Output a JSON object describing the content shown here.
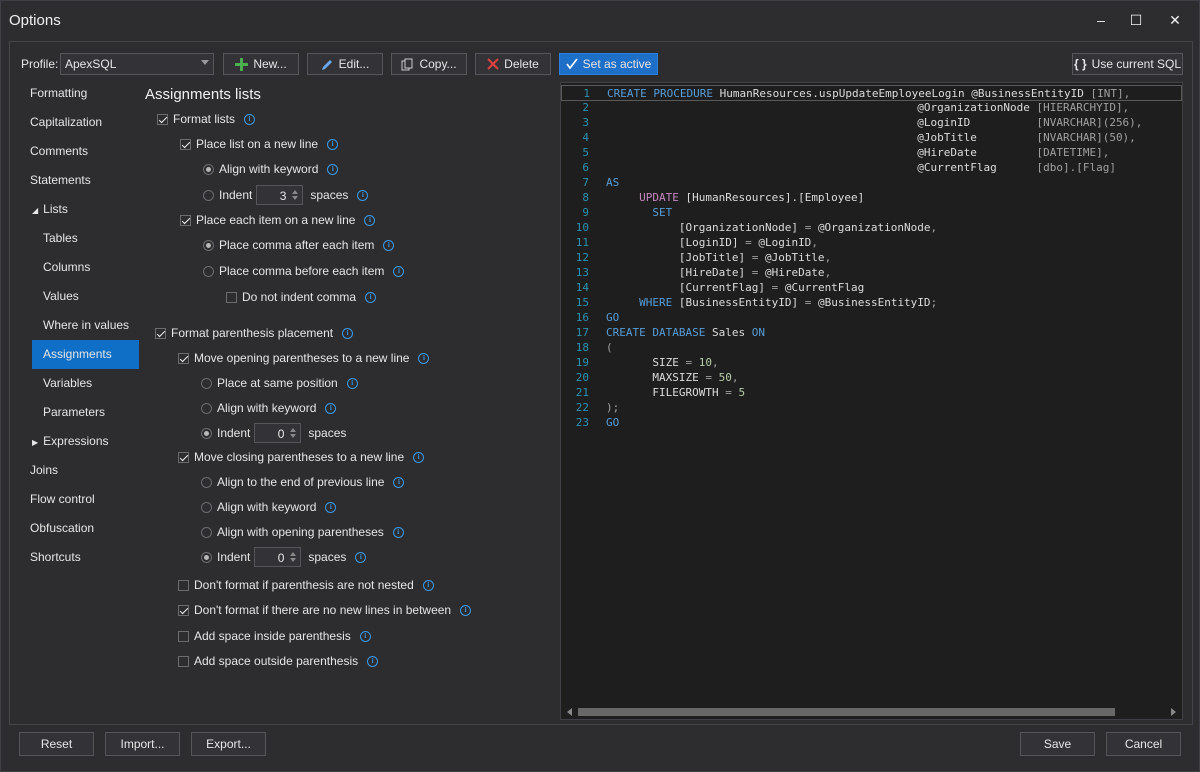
{
  "window": {
    "title": "Options",
    "minimize": "–",
    "maximize": "☐",
    "close": "✕"
  },
  "toolbar": {
    "profile_label": "Profile:",
    "profile_value": "ApexSQL",
    "new_label": "New...",
    "edit_label": "Edit...",
    "copy_label": "Copy...",
    "delete_label": "Delete",
    "set_active_label": "Set as active",
    "use_current_label": "Use current SQL"
  },
  "nav": {
    "items": [
      {
        "label": "Formatting"
      },
      {
        "label": "Capitalization"
      },
      {
        "label": "Comments"
      },
      {
        "label": "Statements"
      },
      {
        "label": "Lists",
        "expander": "◢"
      },
      {
        "label": "Tables"
      },
      {
        "label": "Columns"
      },
      {
        "label": "Values"
      },
      {
        "label": "Where in values"
      },
      {
        "label": "Assignments",
        "selected": true
      },
      {
        "label": "Variables"
      },
      {
        "label": "Parameters"
      },
      {
        "label": "Expressions",
        "expander": "▶"
      },
      {
        "label": "Joins"
      },
      {
        "label": "Flow control"
      },
      {
        "label": "Obfuscation"
      },
      {
        "label": "Shortcuts"
      }
    ]
  },
  "settings": {
    "heading": "Assignments lists",
    "format_lists": "Format lists",
    "place_list_new_line": "Place list on a new line",
    "align_with_keyword": "Align with keyword",
    "indent": "Indent",
    "indent_value_1": "3",
    "spaces": "spaces",
    "place_each_item": "Place each item on a new line",
    "comma_after": "Place comma after each item",
    "comma_before": "Place comma before each item",
    "no_indent_comma": "Do not indent comma",
    "format_paren": "Format parenthesis placement",
    "move_open_paren": "Move opening parentheses to a new line",
    "place_same_pos": "Place at same position",
    "align_keyword_2": "Align with keyword",
    "indent_2": "Indent",
    "indent_value_2": "0",
    "spaces_2": "spaces",
    "move_close_paren": "Move closing parentheses to a new line",
    "align_end_prev": "Align to the end of previous line",
    "align_keyword_3": "Align with keyword",
    "align_open_paren": "Align with opening parentheses",
    "indent_3": "Indent",
    "indent_value_3": "0",
    "spaces_3": "spaces",
    "dont_format_not_nested": "Don't format if parenthesis are not nested",
    "dont_format_no_newlines": "Don't format if there are no new lines in between",
    "add_space_inside": "Add space inside parenthesis",
    "add_space_outside": "Add space outside parenthesis",
    "info": "i"
  },
  "code": {
    "lines": [
      [
        {
          "t": "CREATE PROCEDURE ",
          "c": "kw"
        },
        {
          "t": "HumanResources.uspUpdateEmployeeLogin @BusinessEntityID ",
          "c": "id"
        },
        {
          "t": "[INT],",
          "c": "op"
        }
      ],
      [
        {
          "t": "                                               @OrganizationNode ",
          "c": "id"
        },
        {
          "t": "[HIERARCHYID],",
          "c": "op"
        }
      ],
      [
        {
          "t": "                                               @LoginID          ",
          "c": "id"
        },
        {
          "t": "[NVARCHAR](256),",
          "c": "op"
        }
      ],
      [
        {
          "t": "                                               @JobTitle         ",
          "c": "id"
        },
        {
          "t": "[NVARCHAR](50),",
          "c": "op"
        }
      ],
      [
        {
          "t": "                                               @HireDate         ",
          "c": "id"
        },
        {
          "t": "[DATETIME],",
          "c": "op"
        }
      ],
      [
        {
          "t": "                                               @CurrentFlag      ",
          "c": "id"
        },
        {
          "t": "[dbo].[Flag]",
          "c": "op"
        }
      ],
      [
        {
          "t": "AS",
          "c": "kw"
        }
      ],
      [
        {
          "t": "     ",
          "c": "id"
        },
        {
          "t": "UPDATE ",
          "c": "kw2"
        },
        {
          "t": "[HumanResources].[Employee]",
          "c": "id"
        }
      ],
      [
        {
          "t": "       ",
          "c": "id"
        },
        {
          "t": "SET",
          "c": "kw"
        }
      ],
      [
        {
          "t": "           [OrganizationNode] ",
          "c": "id"
        },
        {
          "t": "= ",
          "c": "op"
        },
        {
          "t": "@OrganizationNode",
          "c": "id"
        },
        {
          "t": ",",
          "c": "op"
        }
      ],
      [
        {
          "t": "           [LoginID] ",
          "c": "id"
        },
        {
          "t": "= ",
          "c": "op"
        },
        {
          "t": "@LoginID",
          "c": "id"
        },
        {
          "t": ",",
          "c": "op"
        }
      ],
      [
        {
          "t": "           [JobTitle] ",
          "c": "id"
        },
        {
          "t": "= ",
          "c": "op"
        },
        {
          "t": "@JobTitle",
          "c": "id"
        },
        {
          "t": ",",
          "c": "op"
        }
      ],
      [
        {
          "t": "           [HireDate] ",
          "c": "id"
        },
        {
          "t": "= ",
          "c": "op"
        },
        {
          "t": "@HireDate",
          "c": "id"
        },
        {
          "t": ",",
          "c": "op"
        }
      ],
      [
        {
          "t": "           [CurrentFlag] ",
          "c": "id"
        },
        {
          "t": "= ",
          "c": "op"
        },
        {
          "t": "@CurrentFlag",
          "c": "id"
        }
      ],
      [
        {
          "t": "     ",
          "c": "id"
        },
        {
          "t": "WHERE ",
          "c": "kw"
        },
        {
          "t": "[BusinessEntityID] ",
          "c": "id"
        },
        {
          "t": "= ",
          "c": "op"
        },
        {
          "t": "@BusinessEntityID",
          "c": "id"
        },
        {
          "t": ";",
          "c": "op"
        }
      ],
      [
        {
          "t": "GO",
          "c": "kw"
        }
      ],
      [
        {
          "t": "CREATE DATABASE ",
          "c": "kw"
        },
        {
          "t": "Sales ",
          "c": "id"
        },
        {
          "t": "ON",
          "c": "kw"
        }
      ],
      [
        {
          "t": "(",
          "c": "op"
        }
      ],
      [
        {
          "t": "       SIZE ",
          "c": "id"
        },
        {
          "t": "= ",
          "c": "op"
        },
        {
          "t": "10",
          "c": "num"
        },
        {
          "t": ",",
          "c": "op"
        }
      ],
      [
        {
          "t": "       MAXSIZE ",
          "c": "id"
        },
        {
          "t": "= ",
          "c": "op"
        },
        {
          "t": "50",
          "c": "num"
        },
        {
          "t": ",",
          "c": "op"
        }
      ],
      [
        {
          "t": "       FILEGROWTH ",
          "c": "id"
        },
        {
          "t": "= ",
          "c": "op"
        },
        {
          "t": "5",
          "c": "num"
        }
      ],
      [
        {
          "t": ");",
          "c": "op"
        }
      ],
      [
        {
          "t": "GO",
          "c": "kw"
        }
      ]
    ],
    "colors": {
      "kw": "#569cd6",
      "kw2": "#c586c0",
      "id": "#dcdcdc",
      "op": "#a0a0a0",
      "num": "#b5cea8"
    }
  },
  "footer": {
    "reset": "Reset",
    "import": "Import...",
    "export": "Export...",
    "save": "Save",
    "cancel": "Cancel"
  }
}
